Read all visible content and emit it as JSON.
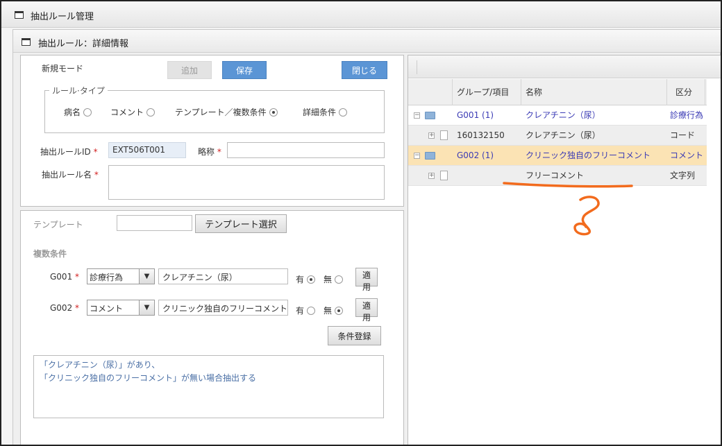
{
  "window": {
    "title": "抽出ルール管理"
  },
  "dialog": {
    "title": "抽出ルール：詳細情報"
  },
  "form": {
    "mode_label": "新規モード",
    "buttons": {
      "add": "追加",
      "save": "保存",
      "close": "閉じる"
    },
    "rule_type": {
      "legend": "ルール·タイプ",
      "options": [
        {
          "label": "病名",
          "selected": false
        },
        {
          "label": "コメント",
          "selected": false
        },
        {
          "label": "テンプレート／複数条件",
          "selected": true
        },
        {
          "label": "詳細条件",
          "selected": false
        }
      ]
    },
    "rule_id": {
      "label": "抽出ルールID",
      "required_mark": "*",
      "value": "EXT506T001"
    },
    "short_name": {
      "label": "略称",
      "required_mark": "*",
      "value": ""
    },
    "rule_name": {
      "label": "抽出ルール名",
      "required_mark": "*",
      "value": ""
    }
  },
  "template_section": {
    "template_label": "テンプレート",
    "template_value": "",
    "template_select_button": "テンプレート選択",
    "multi_label": "複数条件",
    "conditions": [
      {
        "group": "G001",
        "required_mark": "*",
        "type": "診療行為",
        "text": "クレアチニン（尿）",
        "yes_label": "有",
        "no_label": "無",
        "yes_selected": true,
        "apply": "適用"
      },
      {
        "group": "G002",
        "required_mark": "*",
        "type": "コメント",
        "text": "クリニック独自のフリーコメント",
        "yes_label": "有",
        "no_label": "無",
        "yes_selected": false,
        "apply": "適用"
      }
    ],
    "register_button": "条件登録",
    "summary_lines": [
      "「クレアチニン（尿）」があり、",
      "「クリニック独自のフリーコメント」が無い場合抽出する"
    ]
  },
  "tree": {
    "columns": [
      "グループ/項目",
      "名称",
      "区分"
    ],
    "rows": [
      {
        "id": "G001 (1)",
        "name": "クレアチニン（尿）",
        "kind": "診療行為",
        "level": 0,
        "style": "group"
      },
      {
        "id": "160132150",
        "name": "クレアチニン（尿）",
        "kind": "コード",
        "level": 1,
        "style": "item"
      },
      {
        "id": "G002 (1)",
        "name": "クリニック独自のフリーコメント",
        "kind": "コメント",
        "level": 0,
        "style": "group-selected"
      },
      {
        "id": "",
        "name": "フリーコメント",
        "kind": "文字列",
        "level": 1,
        "style": "item"
      }
    ]
  },
  "colors": {
    "annotation": "#f26b1d",
    "required": "#d21f1f",
    "primary_button": "#5b95d5",
    "selected_row": "#fbe3b4"
  },
  "annotation": {
    "mark": "?"
  }
}
